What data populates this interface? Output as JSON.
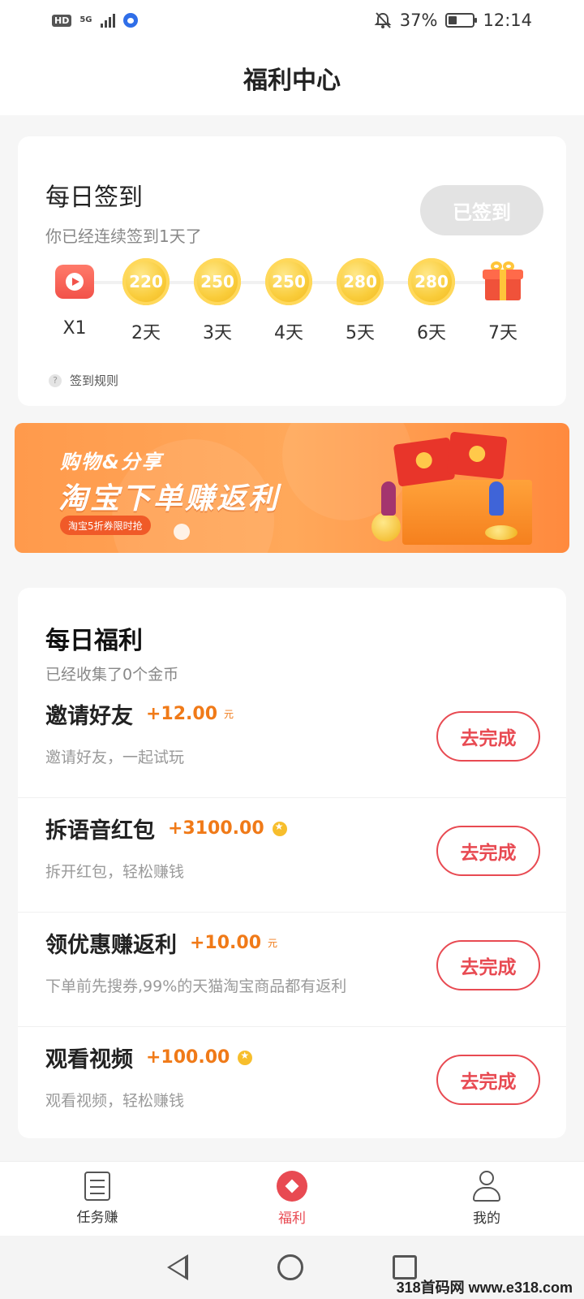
{
  "status_bar": {
    "hd": "HD",
    "network": "5G",
    "battery_pct": "37%",
    "time": "12:14",
    "battery_level": 0.37
  },
  "header": {
    "title": "福利中心"
  },
  "checkin": {
    "title": "每日签到",
    "subtitle": "你已经连续签到1天了",
    "button_label": "已签到",
    "days": [
      {
        "icon": "video-play-icon",
        "value": "",
        "label": "X1"
      },
      {
        "icon": "coin-icon",
        "value": "220",
        "label": "2天"
      },
      {
        "icon": "coin-icon",
        "value": "250",
        "label": "3天"
      },
      {
        "icon": "coin-icon",
        "value": "250",
        "label": "4天"
      },
      {
        "icon": "coin-icon",
        "value": "280",
        "label": "5天"
      },
      {
        "icon": "coin-icon",
        "value": "280",
        "label": "6天"
      },
      {
        "icon": "gift-icon",
        "value": "",
        "label": "7天"
      }
    ],
    "rules_label": "签到规则"
  },
  "banner": {
    "line1": "购物&分享",
    "line2": "淘宝下单赚返利",
    "tag": "淘宝5折券限时抢"
  },
  "welfare": {
    "title": "每日福利",
    "subtitle": "已经收集了0个金币",
    "tasks": [
      {
        "name": "邀请好友",
        "reward": "+12.00",
        "unit": "元",
        "desc": "邀请好友，一起试玩",
        "button": "去完成"
      },
      {
        "name": "拆语音红包",
        "reward": "+3100.00",
        "unit": "",
        "desc": "拆开红包，轻松赚钱",
        "button": "去完成"
      },
      {
        "name": "领优惠赚返利",
        "reward": "+10.00",
        "unit": "元",
        "desc": "下单前先搜券,99%的天猫淘宝商品都有返利",
        "button": "去完成"
      },
      {
        "name": "观看视频",
        "reward": "+100.00",
        "unit": "",
        "desc": "观看视频，轻松赚钱",
        "button": "去完成"
      }
    ]
  },
  "tab_bar": {
    "tabs": [
      {
        "label": "任务赚",
        "icon": "task-list-icon"
      },
      {
        "label": "福利",
        "icon": "welfare-diamond-icon"
      },
      {
        "label": "我的",
        "icon": "user-icon"
      }
    ],
    "active": "福利"
  },
  "watermark": "318首码网 www.e318.com",
  "colors": {
    "accent": "#e84a52",
    "reward": "#f07a18",
    "coin": "#f9cc3a",
    "banner": "#ff9a4c"
  }
}
